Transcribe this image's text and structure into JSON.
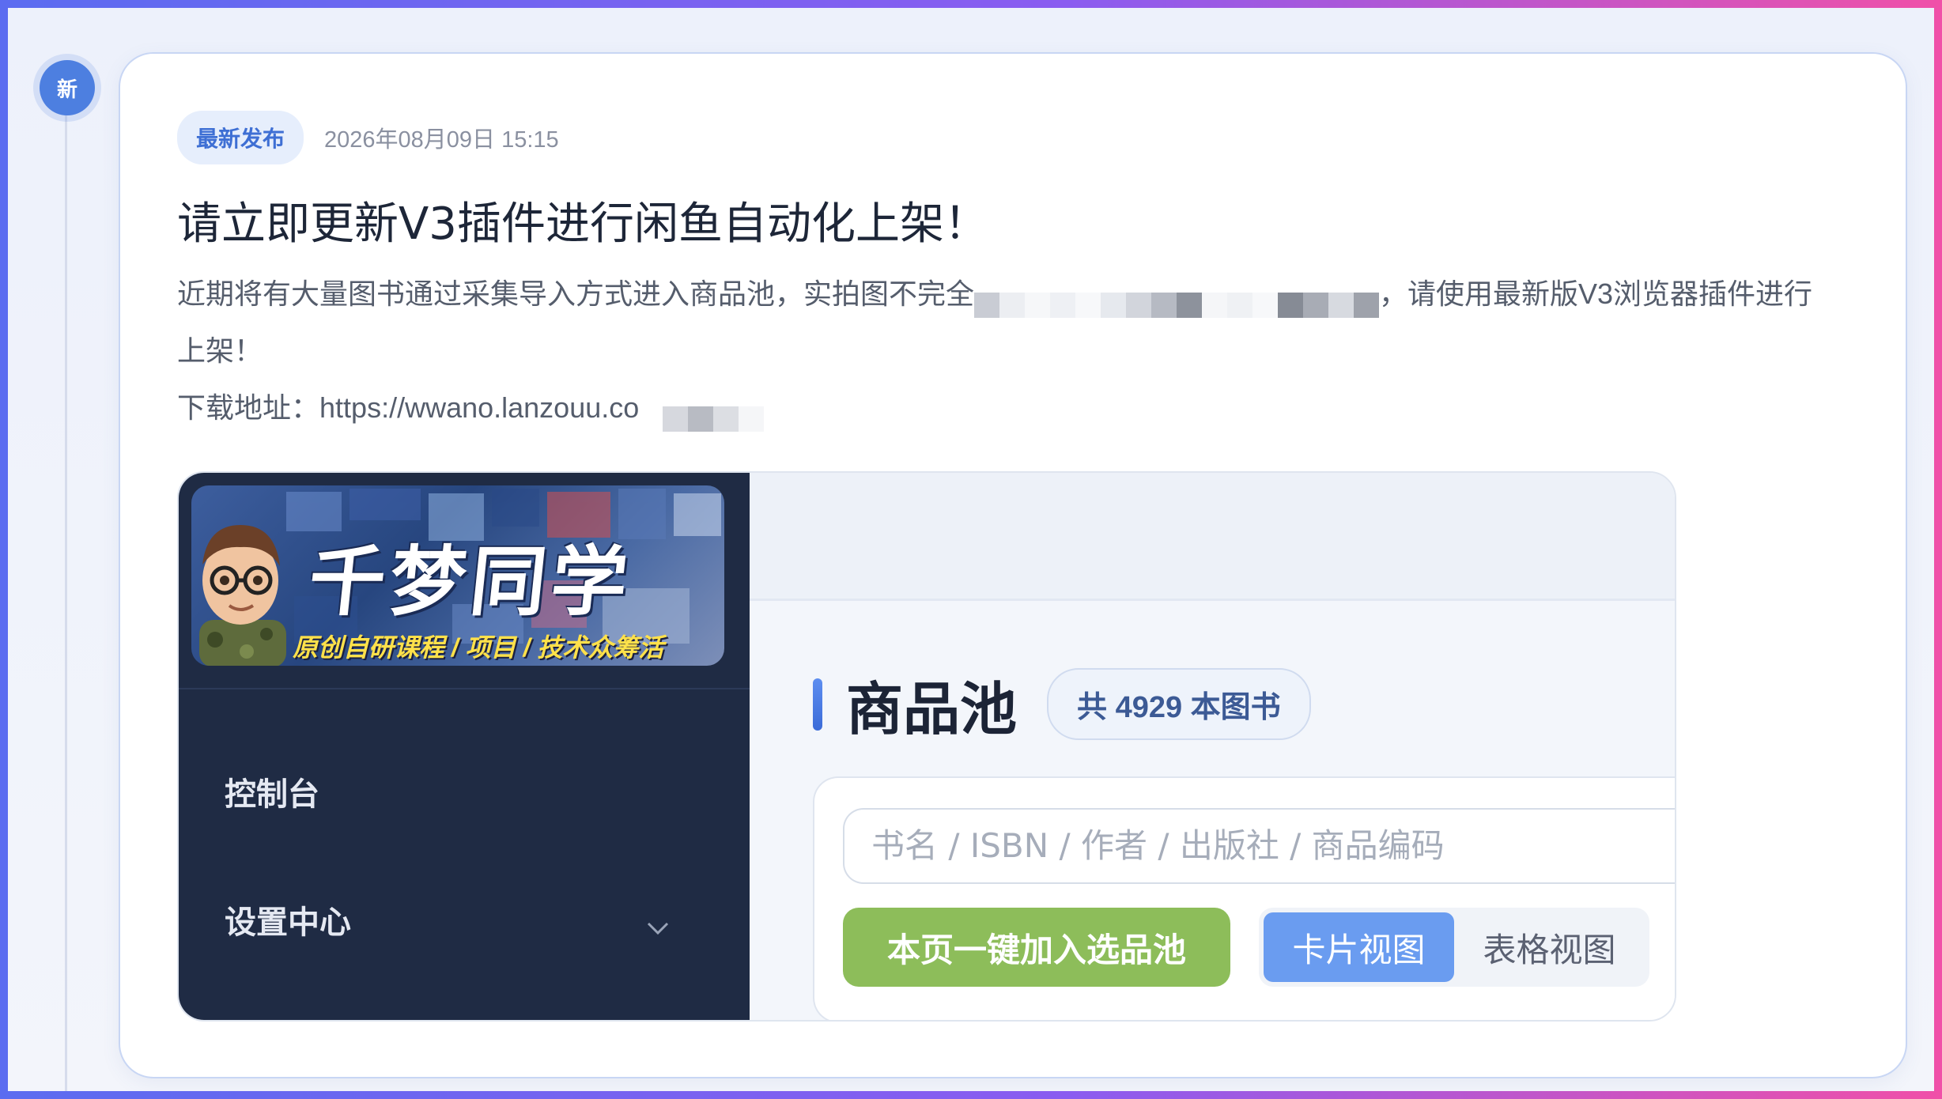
{
  "timeline": {
    "marker": "新"
  },
  "post": {
    "badge": "最新发布",
    "date": "2026年08月09日 15:15",
    "title": "请立即更新V3插件进行闲鱼自动化上架！",
    "desc_line1_a": "近期将有大量图书通过采集导入方式进入商品池，实拍图不完全",
    "desc_line1_b": "，请使用最新版V3浏览器插件进行",
    "desc_line2": "上架！",
    "download_label": "下载地址：",
    "download_url": "https://wwano.lanzouu.co"
  },
  "screenshot": {
    "banner": {
      "brand": "千梦同学",
      "tagline": "原创自研课程 / 项目 / 技术众筹活"
    },
    "sidebar": {
      "items": [
        {
          "label": "控制台"
        },
        {
          "label": "设置中心"
        }
      ]
    },
    "page": {
      "title": "商品池",
      "count": "共 4929 本图书",
      "search_placeholder": "书名 / ISBN / 作者 / 出版社 / 商品编码",
      "add_button": "本页一键加入选品池",
      "views": [
        {
          "label": "卡片视图",
          "active": true
        },
        {
          "label": "表格视图",
          "active": false
        }
      ]
    }
  },
  "colors": {
    "accent": "#4d7fe0",
    "sidebar": "#1f2b44",
    "add_button": "#8dbd5a",
    "active_view": "#6a9cf0"
  }
}
